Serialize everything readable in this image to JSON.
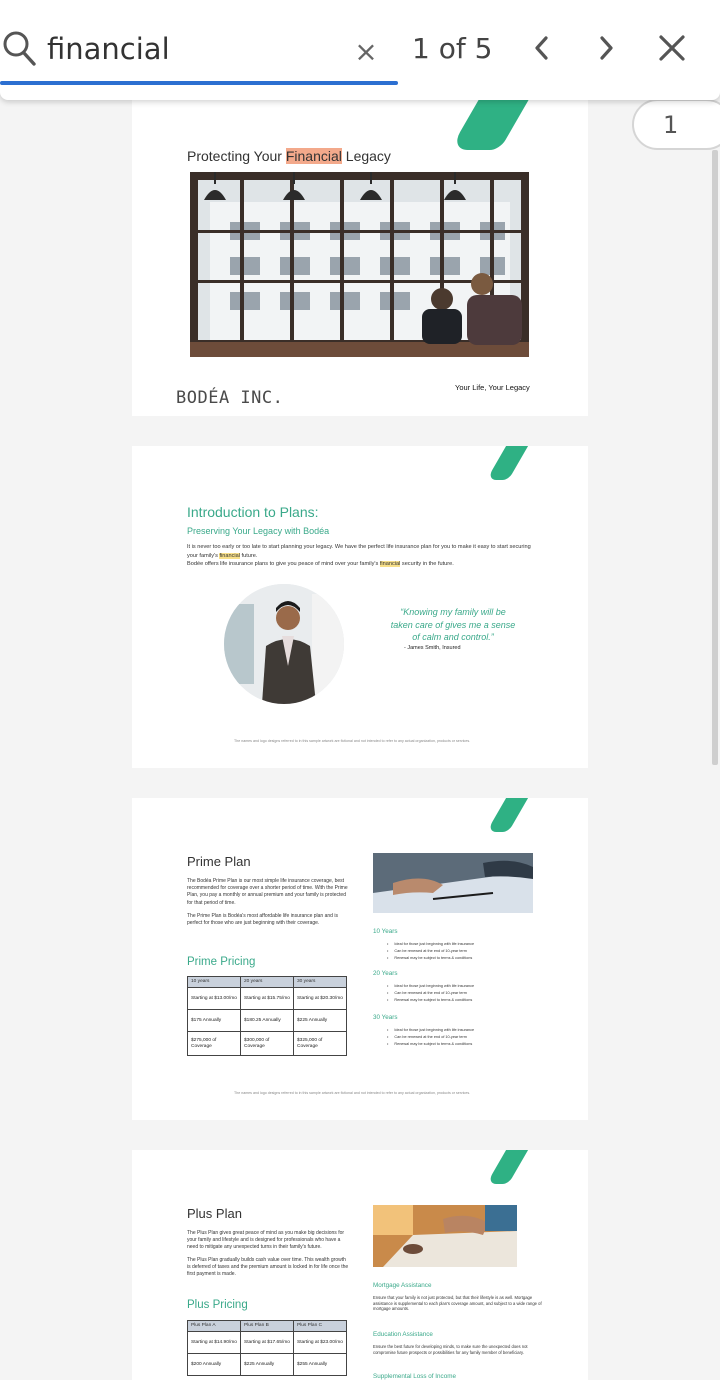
{
  "find": {
    "query": "financial",
    "clear_symbol": "×",
    "match_count": "1 of 5"
  },
  "page_badge": "1",
  "colors": {
    "accent_blue": "#2c6fd1",
    "brand_teal": "#2fb184",
    "match_current": "#f3a98b",
    "match_other": "#f8e08a"
  },
  "page1": {
    "title_before": "Protecting Your ",
    "title_match": "Financial",
    "title_after": " Legacy",
    "logo": "BODÉA INC.",
    "tagline": "Your Life, Your Legacy"
  },
  "page2": {
    "heading": "Introduction to Plans:",
    "subheading": "Preserving Your Legacy with Bodéa",
    "body1_a": "It is never too early or too late to start planning your legacy. We have the perfect life insurance plan for you to make it easy to start securing your family's ",
    "body1_match": "financial",
    "body1_b": " future.",
    "body2_a": "Bodée offers life insurance plans to give you peace of mind over your family's ",
    "body2_match": "financial",
    "body2_b": " security in the future.",
    "quote": "“Knowing my family will be taken care of gives me a sense of calm and control.”",
    "attribution": "-        James Smith, Insured",
    "footnote": "The names and logo designs referred to in this sample artwork are fictional and not intended to refer to any actual organization, products or services."
  },
  "page3": {
    "title": "Prime Plan",
    "body1": "The Bodéa Prime Plan is our most simple life insurance coverage, best recommended for coverage over a shorter period of time. With the Prime Plan, you pay a monthly or annual premium and your family is protected for that period of time.",
    "body2": "The Prime Plan is Bodéa's most affordable life insurance plan and is perfect for those who are just beginning with their coverage.",
    "pricing_heading": "Prime Pricing",
    "table": [
      [
        "10 years",
        "20 years",
        "30 years"
      ],
      [
        "Starting at $13.00/mo",
        "Starting at $15.75/mo",
        "Starting at $20.30/mo"
      ],
      [
        "$175 Annually",
        "$180.25 Annually",
        "$225 Annually"
      ],
      [
        "$275,000 of Coverage",
        "$300,000 of Coverage",
        "$325,000 of Coverage"
      ]
    ],
    "side": [
      {
        "heading": "10 Years",
        "items": [
          "Ideal for those just beginning with life insurance",
          "Can be renewed at the end of 10-year term",
          "Renewal may be subject to terms & conditions"
        ]
      },
      {
        "heading": "20 Years",
        "items": [
          "Ideal for those just beginning with life insurance",
          "Can be renewed at the end of 10-year term",
          "Renewal may be subject to terms & conditions"
        ]
      },
      {
        "heading": "30 Years",
        "items": [
          "Ideal for those just beginning with life insurance",
          "Can be renewed at the end of 10-year term",
          "Renewal may be subject to terms & conditions"
        ]
      }
    ],
    "footnote": "The names and logo designs referred to in this sample artwork are fictional and not intended to refer to any actual organization, products or services."
  },
  "page4": {
    "title": "Plus Plan",
    "body1": "The Plus Plan gives great peace of mind as you make big decisions for your family and lifestyle and is designed for professionals who have a need to mitigate any unexpected turns in their family's future.",
    "body2": "The Plus Plan gradually builds cash value over time. This wealth growth is deferred of taxes and the premium amount is locked in for life once the first payment is made.",
    "pricing_heading": "Plus Pricing",
    "table": [
      [
        "Plus Plan A",
        "Plus Plan B",
        "Plus Plan C"
      ],
      [
        "Starting at $14.90/mo",
        "Starting at $17.65/mo",
        "Starting at $23.00/mo"
      ],
      [
        "$200 Annually",
        "$225 Annually",
        "$255 Annually"
      ]
    ],
    "side": [
      {
        "heading": "Mortgage Assistance",
        "body": "Ensure that your family is not just protected, but that their lifestyle is as well. Mortgage assistance is supplemental to each plan's coverage amount, and subject to a wide range of mortgage amounts."
      },
      {
        "heading": "Education Assistance",
        "body": "Ensure the best future for developing minds, to make sure the unexpected does not compromise future prospects or possibilities for any family member of beneficiary."
      },
      {
        "heading": "Supplemental Loss of Income",
        "body": ""
      }
    ]
  }
}
